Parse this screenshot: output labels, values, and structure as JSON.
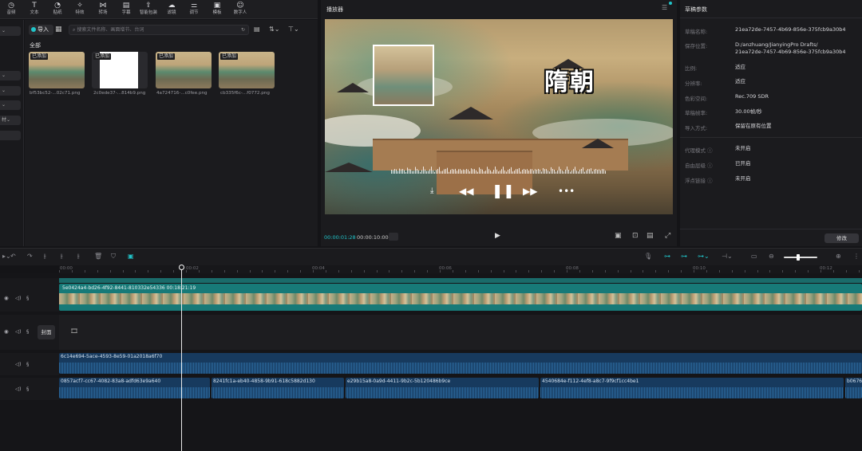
{
  "top_toolbar": {
    "items": [
      {
        "label": "音频",
        "icon": "audio-icon"
      },
      {
        "label": "文本",
        "icon": "text-icon"
      },
      {
        "label": "贴纸",
        "icon": "sticker-icon"
      },
      {
        "label": "特效",
        "icon": "effects-icon"
      },
      {
        "label": "转场",
        "icon": "transition-icon"
      },
      {
        "label": "字幕",
        "icon": "subtitle-icon"
      },
      {
        "label": "智能包装",
        "icon": "smart-pack-icon"
      },
      {
        "label": "滤镜",
        "icon": "filter-icon"
      },
      {
        "label": "调节",
        "icon": "adjust-icon"
      },
      {
        "label": "模板",
        "icon": "template-icon"
      },
      {
        "label": "数字人",
        "icon": "digital-human-icon"
      }
    ]
  },
  "left_panel": {
    "items": [
      "材"
    ]
  },
  "media": {
    "import_label": "导入",
    "search_placeholder": "搜索文件名称、画面增节、台词",
    "section_label": "全部",
    "items": [
      {
        "badge": "已添加",
        "name": "bf53bc52-...02c71.png",
        "kind": "scene"
      },
      {
        "badge": "已添加",
        "name": "2c0ede37-...814b9.png",
        "kind": "white"
      },
      {
        "badge": "已添加",
        "name": "4a724716-...c0fee.png",
        "kind": "scene"
      },
      {
        "badge": "已添加",
        "name": "cb335f6c-...f0772.png",
        "kind": "scene"
      }
    ]
  },
  "player": {
    "title": "播放器",
    "video_title": "隋朝",
    "time_current": "00:00:01:28",
    "time_total": "00:00:10:00"
  },
  "params": {
    "title": "草稿参数",
    "rows": [
      {
        "label": "草稿名称:",
        "value": "21ea72de-7457-4b69-856e-375fcb9a30b4"
      },
      {
        "label": "保存位置:",
        "value": "D:/anzhuang/JianyingPro Drafts/\n21ea72de-7457-4b69-856e-375fcb9a30b4"
      },
      {
        "label": "比例:",
        "value": "适应"
      },
      {
        "label": "分辨率:",
        "value": "适应"
      },
      {
        "label": "色彩空间:",
        "value": "Rec.709 SDR"
      },
      {
        "label": "草稿帧率:",
        "value": "30.00帧/秒"
      },
      {
        "label": "导入方式:",
        "value": "保留在原有位置"
      },
      {
        "label": "代理模式 ⓘ",
        "value": "未开启"
      },
      {
        "label": "自由层级 ⓘ",
        "value": "已开启"
      },
      {
        "label": "浮点链接 ⓘ",
        "value": "未开启"
      }
    ],
    "edit_label": "修改"
  },
  "timeline": {
    "ruler": [
      "00:00",
      "00:02",
      "00:04",
      "00:06",
      "00:08",
      "00:10",
      "00:12"
    ],
    "main_clip_label": "5e0424a4-bd26-4f92-8441-810332e54336  00:18:21:19",
    "cover_label": "封面",
    "audio_clips_row1": [
      {
        "label": "6c14e694-5ace-4593-8e59-01a2018a6f70"
      }
    ],
    "audio_clips_row2": [
      {
        "label": "0857acf7-cc67-4082-83a8-adfd63e9a640"
      },
      {
        "label": "8241fc1a-eb40-4858-9b91-618c5882d130"
      },
      {
        "label": "e29b15a8-0a9d-4411-9b2c-5b120486b9ce"
      },
      {
        "label": "4540684e-f112-4ef8-a8c7-9f9cf1cc4be1"
      },
      {
        "label": "b0676"
      }
    ]
  }
}
